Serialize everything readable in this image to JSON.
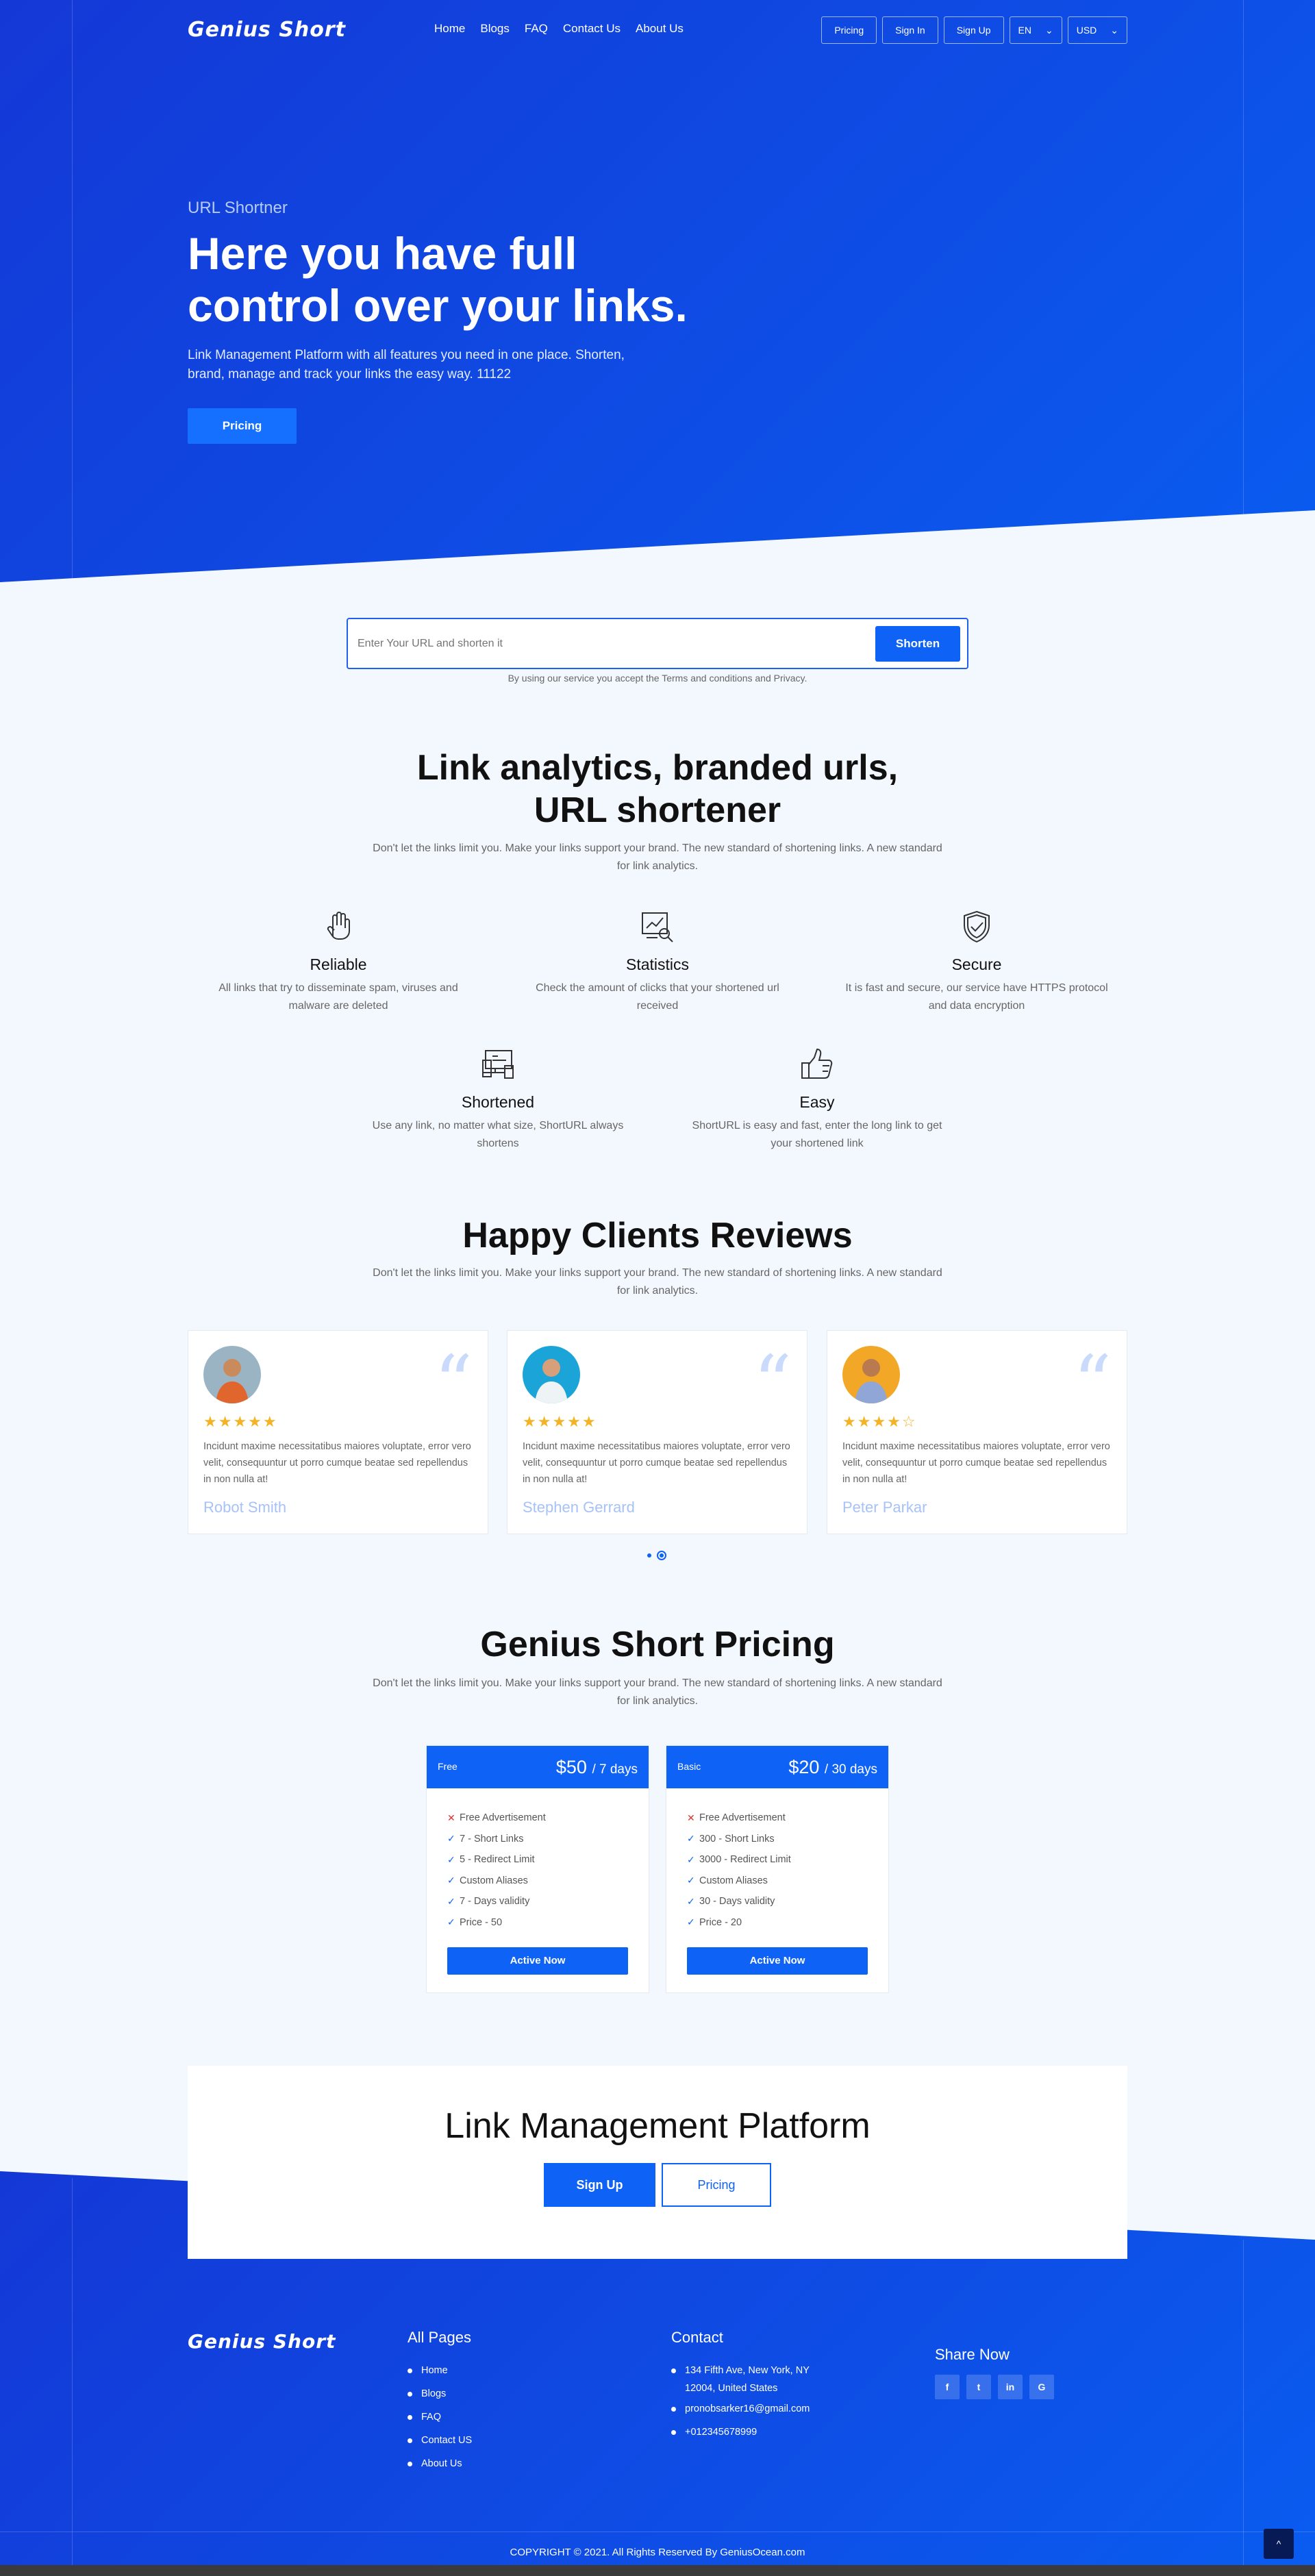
{
  "header": {
    "logo": "Genius Short",
    "menu": [
      "Home",
      "Blogs",
      "FAQ",
      "Contact Us",
      "About Us"
    ],
    "buttons": [
      "Pricing",
      "Sign In",
      "Sign Up"
    ],
    "language": "EN",
    "currency": "USD"
  },
  "hero": {
    "subtitle": "URL Shortner",
    "title": "Here you have full control over your links.",
    "description": "Link Management Platform with all features you need in one place. Shorten, brand, manage and track your links the easy way. 11122",
    "button": "Pricing"
  },
  "shortener": {
    "placeholder": "Enter Your URL and shorten it",
    "button": "Shorten",
    "note": "By using our service you accept the Terms and conditions and Privacy."
  },
  "features": {
    "title": "Link analytics, branded urls, URL shortener",
    "lead": "Don't let the links limit you. Make your links support your brand. The new standard of shortening links. A new standard for link analytics.",
    "items": [
      {
        "icon": "hand-icon",
        "title": "Reliable",
        "text": "All links that try to disseminate spam, viruses and malware are deleted"
      },
      {
        "icon": "statistics-icon",
        "title": "Statistics",
        "text": "Check the amount of clicks that your shortened url received"
      },
      {
        "icon": "shield-check-icon",
        "title": "Secure",
        "text": "It is fast and secure, our service have HTTPS protocol and data encryption"
      },
      {
        "icon": "devices-icon",
        "title": "Shortened",
        "text": "Use any link, no matter what size, ShortURL always shortens"
      },
      {
        "icon": "thumbs-up-icon",
        "title": "Easy",
        "text": "ShortURL is easy and fast, enter the long link to get your shortened link"
      }
    ]
  },
  "reviews": {
    "title": "Happy Clients Reviews",
    "lead": "Don't let the links limit you. Make your links support your brand. The new standard of shortening links. A new standard for link analytics.",
    "items": [
      {
        "name": "Robot Smith",
        "rating": 5,
        "stars": "★★★★★",
        "text": "Incidunt maxime necessitatibus maiores voluptate, error vero velit, consequuntur ut porro cumque beatae sed repellendus in non nulla at!"
      },
      {
        "name": "Stephen Gerrard",
        "rating": 5,
        "stars": "★★★★★",
        "text": "Incidunt maxime necessitatibus maiores voluptate, error vero velit, consequuntur ut porro cumque beatae sed repellendus in non nulla at!"
      },
      {
        "name": "Peter Parkar",
        "rating": 4,
        "stars": "★★★★☆",
        "text": "Incidunt maxime necessitatibus maiores voluptate, error vero velit, consequuntur ut porro cumque beatae sed repellendus in non nulla at!"
      }
    ]
  },
  "pricing": {
    "title": "Genius Short Pricing",
    "lead": "Don't let the links limit you. Make your links support your brand. The new standard of shortening links. A new standard for link analytics.",
    "plans": [
      {
        "name": "Free",
        "price": "$50",
        "period": "/ 7 days",
        "button": "Active Now",
        "features": [
          {
            "ok": false,
            "text": "Free Advertisement"
          },
          {
            "ok": true,
            "text": "7 - Short Links"
          },
          {
            "ok": true,
            "text": "5 - Redirect Limit"
          },
          {
            "ok": true,
            "text": "Custom Aliases"
          },
          {
            "ok": true,
            "text": "7 - Days validity"
          },
          {
            "ok": true,
            "text": "Price - 50"
          }
        ]
      },
      {
        "name": "Basic",
        "price": "$20",
        "period": "/ 30 days",
        "button": "Active Now",
        "features": [
          {
            "ok": false,
            "text": "Free Advertisement"
          },
          {
            "ok": true,
            "text": "300 - Short Links"
          },
          {
            "ok": true,
            "text": "3000 - Redirect Limit"
          },
          {
            "ok": true,
            "text": "Custom Aliases"
          },
          {
            "ok": true,
            "text": "30 - Days validity"
          },
          {
            "ok": true,
            "text": "Price - 20"
          }
        ]
      }
    ]
  },
  "cta": {
    "title": "Link Management Platform",
    "signup": "Sign Up",
    "pricing": "Pricing"
  },
  "footer": {
    "logo": "Genius Short",
    "pages_title": "All Pages",
    "pages": [
      "Home",
      "Blogs",
      "FAQ",
      "Contact US",
      "About Us"
    ],
    "contact_title": "Contact",
    "contact": [
      "134 Fifth Ave, New York, NY 12004, United States",
      "pronobsarker16@gmail.com",
      "+012345678999"
    ],
    "share_title": "Share Now",
    "social": [
      {
        "icon": "facebook-icon",
        "glyph": "f"
      },
      {
        "icon": "twitter-icon",
        "glyph": "t"
      },
      {
        "icon": "linkedin-icon",
        "glyph": "in"
      },
      {
        "icon": "google-icon",
        "glyph": "G"
      }
    ],
    "copyright": "COPYRIGHT © 2021. All Rights Reserved By GeniusOcean.com",
    "to_top": "^"
  },
  "colors": {
    "primary": "#0e62f5",
    "hero_start": "#1438d6",
    "star": "#f4b324"
  }
}
